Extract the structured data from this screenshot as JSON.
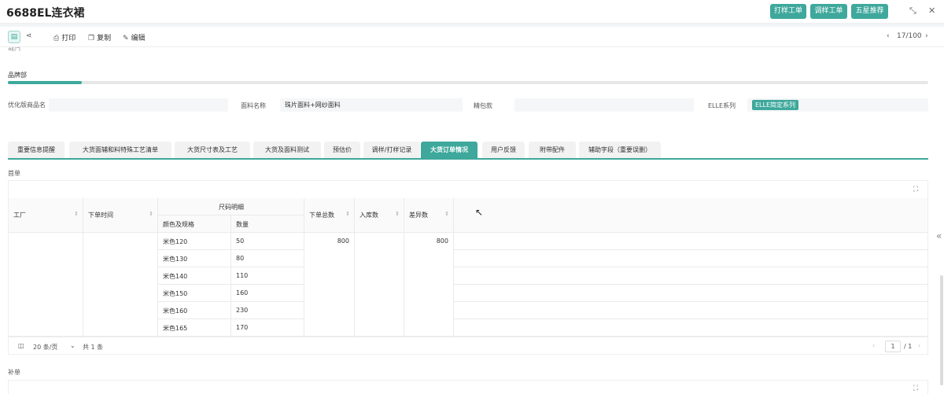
{
  "header": {
    "title": "6688EL连衣裙",
    "buttons": [
      "打样工单",
      "调样工单",
      "五星推荐"
    ],
    "expand_icon": "collapse-arrows-icon",
    "close_icon": "close-icon"
  },
  "toolbar": {
    "print": "打印",
    "copy": "复制",
    "edit": "编辑",
    "pager": "17/100"
  },
  "form": {
    "fragment_text": "部门",
    "department_value": "品牌部",
    "progress_ratio": 0.08,
    "fields": {
      "optimized_vendor_label": "优化版商品名",
      "optimized_vendor_value": "",
      "fabric_name_label": "面料名称",
      "fabric_name_value": "珠片面料+网纱面料",
      "packaging_label": "精包款",
      "packaging_value": "",
      "elle_series_label": "ELLE系列",
      "elle_series_value": "ELLE简定系列"
    }
  },
  "tabs": [
    {
      "label": "重要信息提醒",
      "active": false
    },
    {
      "label": "大货面辅和料特殊工艺清单",
      "active": false
    },
    {
      "label": "大货尺寸表及工艺",
      "active": false
    },
    {
      "label": "大货及面料测试",
      "active": false
    },
    {
      "label": "预估价",
      "active": false
    },
    {
      "label": "调样/打样记录",
      "active": false
    },
    {
      "label": "大货订单情况",
      "active": true
    },
    {
      "label": "用户反馈",
      "active": false
    },
    {
      "label": "附带配件",
      "active": false
    },
    {
      "label": "辅助字段（重要误删）",
      "active": false
    }
  ],
  "first_order": {
    "section_label": "首单",
    "columns": {
      "factory": "工厂",
      "order_time": "下单时间",
      "size_detail": "尺码明细",
      "color_spec": "颜色及规格",
      "quantity": "数量",
      "total_ordered": "下单总数",
      "stocked": "入库数",
      "difference": "差异数"
    },
    "rows": [
      {
        "color": "米色120",
        "qty": "50"
      },
      {
        "color": "米色130",
        "qty": "80"
      },
      {
        "color": "米色140",
        "qty": "110"
      },
      {
        "color": "米色150",
        "qty": "160"
      },
      {
        "color": "米色160",
        "qty": "230"
      },
      {
        "color": "米色165",
        "qty": "170"
      }
    ],
    "total_ordered": "800",
    "difference": "800",
    "footer": {
      "page_size": "20 条/页",
      "total": "共 1 条",
      "current_page": "1",
      "page_total": "/ 1"
    }
  },
  "supplement": {
    "section_label": "补单"
  }
}
